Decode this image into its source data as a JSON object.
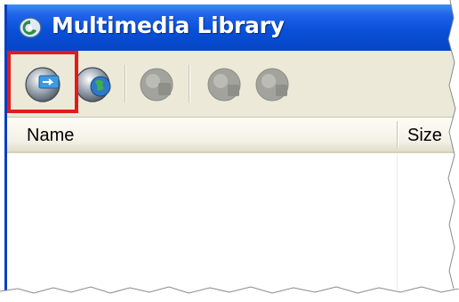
{
  "window": {
    "title": "Multimedia Library"
  },
  "toolbar": {
    "buttons": [
      {
        "name": "import",
        "icon": "disc-import-icon",
        "state": "enabled",
        "highlighted": true
      },
      {
        "name": "globe",
        "icon": "disc-globe-icon",
        "state": "enabled"
      },
      {
        "name": "disabled-1",
        "icon": "disc-icon",
        "state": "disabled"
      },
      {
        "name": "disabled-2",
        "icon": "disc-icon",
        "state": "disabled"
      },
      {
        "name": "disabled-3",
        "icon": "disc-icon",
        "state": "disabled"
      }
    ],
    "highlight_color": "#e01b1b"
  },
  "list": {
    "columns": [
      "Name",
      "Size"
    ],
    "rows": []
  },
  "colors": {
    "titlebar": "#0a50d8",
    "toolbar_bg": "#ece9d8"
  }
}
